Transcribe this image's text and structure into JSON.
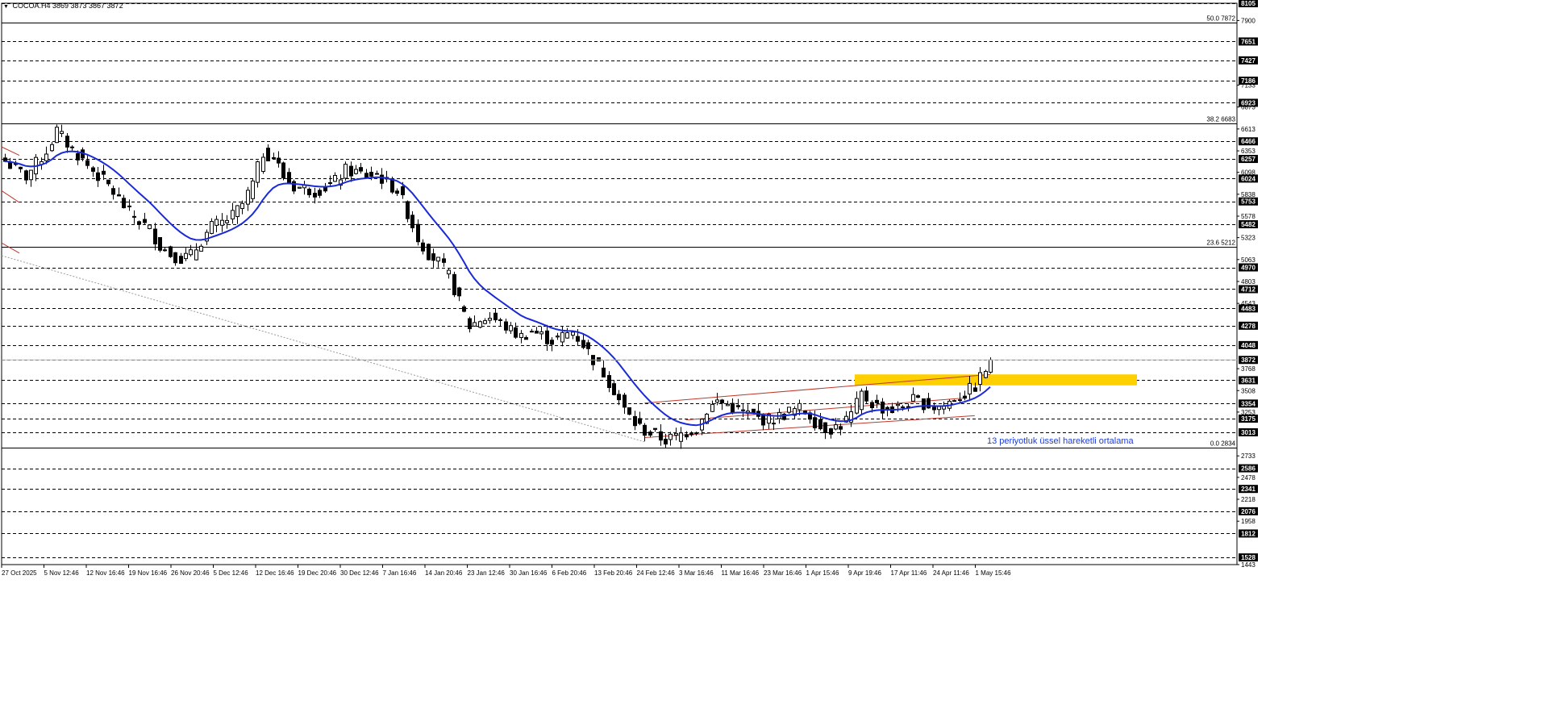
{
  "header": {
    "symbol": "COCOA.H4",
    "ohlc": "3869 3873 3867 3872"
  },
  "annotation_text": "13 periyotluk üssel hareketli ortalama",
  "colors": {
    "candle": "#000000",
    "ema": "#1a2ad6",
    "channel": "#c0392b",
    "highlight": "#ffd000",
    "grid": "#000000",
    "fib": "#000000",
    "trend_dotted": "#9a9a9a"
  },
  "chart_data": {
    "type": "candlestick",
    "title": "COCOA.H4",
    "price_range": [
      1443,
      8105
    ],
    "grid": true,
    "x_tick_labels": [
      "27 Oct 2025",
      "5 Nov 12:46",
      "12 Nov 16:46",
      "19 Nov 16:46",
      "26 Nov 20:46",
      "5 Dec 12:46",
      "12 Dec 16:46",
      "19 Dec 20:46",
      "30 Dec 12:46",
      "7 Jan 16:46",
      "14 Jan 20:46",
      "23 Jan 12:46",
      "30 Jan 16:46",
      "6 Feb 20:46",
      "13 Feb 20:46",
      "24 Feb 12:46",
      "3 Mar 16:46",
      "11 Mar 16:46",
      "23 Mar 16:46",
      "1 Apr 15:46",
      "9 Apr 19:46",
      "17 Apr 11:46",
      "24 Apr 11:46",
      "1 May 15:46"
    ],
    "y_boxed_labels": [
      "8105",
      "7651",
      "7427",
      "7186",
      "6923",
      "6466",
      "6257",
      "6024",
      "5753",
      "5482",
      "4970",
      "4712",
      "4483",
      "4278",
      "4048",
      "3872",
      "3631",
      "3354",
      "3175",
      "3013",
      "2586",
      "2341",
      "2076",
      "1812",
      "1528"
    ],
    "y_plain_labels": [
      "7900",
      "7133",
      "6873",
      "6613",
      "6353",
      "6098",
      "5838",
      "5578",
      "5323",
      "5063",
      "4803",
      "4543",
      "3768",
      "3508",
      "3253",
      "2733",
      "2478",
      "2218",
      "1958",
      "1443"
    ],
    "fibonacci_levels": [
      {
        "label": "50.0 7872",
        "price": 7872
      },
      {
        "label": "38.2 6683",
        "price": 6683
      },
      {
        "label": "23.6 5212",
        "price": 5212
      },
      {
        "label": "0.0 2834",
        "price": 2834
      }
    ],
    "current_price": 3872,
    "ohlc_last": {
      "open": 3869,
      "high": 3873,
      "low": 3867,
      "close": 3872
    },
    "resistance_zone": [
      3570,
      3700
    ],
    "price_path": [
      [
        0,
        6230
      ],
      [
        4,
        6050
      ],
      [
        8,
        6350
      ],
      [
        10,
        6590
      ],
      [
        12,
        6440
      ],
      [
        16,
        6180
      ],
      [
        20,
        5940
      ],
      [
        24,
        5620
      ],
      [
        28,
        5420
      ],
      [
        30,
        5230
      ],
      [
        32,
        5130
      ],
      [
        34,
        5080
      ],
      [
        36,
        5110
      ],
      [
        38,
        5290
      ],
      [
        40,
        5450
      ],
      [
        42,
        5500
      ],
      [
        44,
        5580
      ],
      [
        46,
        5720
      ],
      [
        48,
        5960
      ],
      [
        50,
        6330
      ],
      [
        52,
        6290
      ],
      [
        54,
        6050
      ],
      [
        56,
        5930
      ],
      [
        58,
        5910
      ],
      [
        60,
        5880
      ],
      [
        62,
        5920
      ],
      [
        64,
        5990
      ],
      [
        66,
        6120
      ],
      [
        68,
        6100
      ],
      [
        70,
        6060
      ],
      [
        72,
        6080
      ],
      [
        74,
        5970
      ],
      [
        76,
        5890
      ],
      [
        78,
        5620
      ],
      [
        80,
        5320
      ],
      [
        82,
        5140
      ],
      [
        84,
        5030
      ],
      [
        86,
        4870
      ],
      [
        88,
        4560
      ],
      [
        90,
        4270
      ],
      [
        92,
        4350
      ],
      [
        94,
        4380
      ],
      [
        96,
        4310
      ],
      [
        98,
        4220
      ],
      [
        100,
        4150
      ],
      [
        102,
        4220
      ],
      [
        104,
        4160
      ],
      [
        106,
        4100
      ],
      [
        108,
        4150
      ],
      [
        110,
        4210
      ],
      [
        112,
        4060
      ],
      [
        114,
        3880
      ],
      [
        116,
        3720
      ],
      [
        118,
        3520
      ],
      [
        120,
        3280
      ],
      [
        122,
        3120
      ],
      [
        124,
        3030
      ],
      [
        126,
        2980
      ],
      [
        128,
        2920
      ],
      [
        130,
        2960
      ],
      [
        132,
        3020
      ],
      [
        134,
        3060
      ],
      [
        136,
        3280
      ],
      [
        138,
        3380
      ],
      [
        140,
        3340
      ],
      [
        142,
        3270
      ],
      [
        144,
        3230
      ],
      [
        146,
        3180
      ],
      [
        148,
        3160
      ],
      [
        150,
        3200
      ],
      [
        152,
        3260
      ],
      [
        154,
        3290
      ],
      [
        156,
        3220
      ],
      [
        158,
        3070
      ],
      [
        160,
        3060
      ],
      [
        162,
        3100
      ],
      [
        164,
        3220
      ],
      [
        166,
        3460
      ],
      [
        168,
        3360
      ],
      [
        170,
        3300
      ],
      [
        172,
        3280
      ],
      [
        174,
        3320
      ],
      [
        176,
        3390
      ],
      [
        178,
        3360
      ],
      [
        180,
        3310
      ],
      [
        182,
        3330
      ],
      [
        184,
        3420
      ],
      [
        186,
        3470
      ],
      [
        188,
        3560
      ],
      [
        190,
        3760
      ],
      [
        191,
        3872
      ]
    ],
    "ema_period": 13,
    "channel_lines": [
      {
        "from": [
          124,
          3360
        ],
        "to": [
          191,
          3700
        ]
      },
      {
        "from": [
          124,
          2950
        ],
        "to": [
          188,
          3210
        ]
      },
      {
        "from": [
          132,
          3160
        ],
        "to": [
          186,
          3420
        ]
      }
    ]
  }
}
